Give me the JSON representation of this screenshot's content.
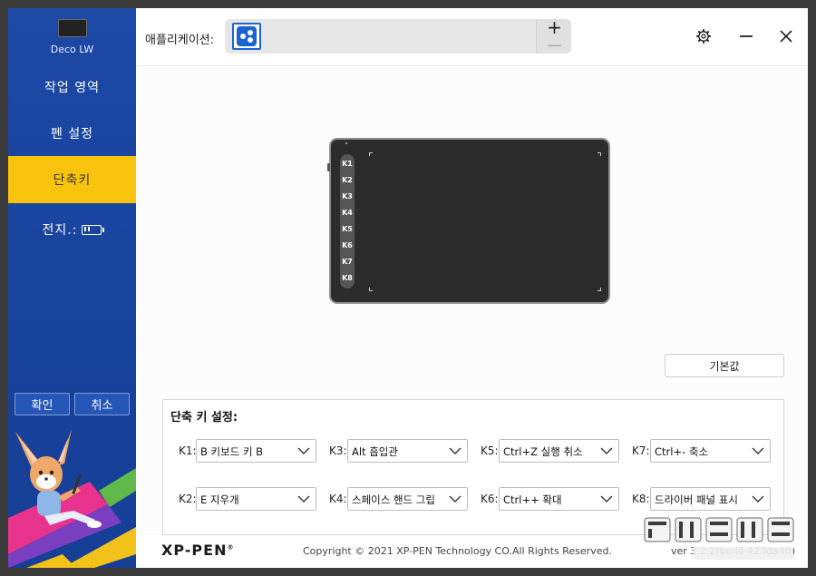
{
  "sidebar": {
    "device_name": "Deco LW",
    "nav": [
      {
        "label": "작업 영역"
      },
      {
        "label": "펜 설정"
      },
      {
        "label": "단축키"
      },
      {
        "label": "전지.:"
      }
    ],
    "confirm_label": "확인",
    "cancel_label": "취소"
  },
  "header": {
    "app_label": "애플리케이션:",
    "plus": "+",
    "minus": "—",
    "icons": [
      "settings-gear-icon",
      "minimize-icon",
      "close-icon"
    ]
  },
  "tablet": {
    "keys": [
      "K1",
      "K2",
      "K3",
      "K4",
      "K5",
      "K6",
      "K7",
      "K8"
    ]
  },
  "default_button": "기본값",
  "shortcut_settings": {
    "title": "단축 키 설정:",
    "rows": [
      [
        {
          "key": "K1:",
          "value": "B 키보드 키 B"
        },
        {
          "key": "K3:",
          "value": "Alt 흡입관"
        },
        {
          "key": "K5:",
          "value": "Ctrl+Z 실행 취소"
        },
        {
          "key": "K7:",
          "value": "Ctrl+- 축소"
        }
      ],
      [
        {
          "key": "K2:",
          "value": "E 지우개"
        },
        {
          "key": "K4:",
          "value": "스페이스 핸드 그립"
        },
        {
          "key": "K6:",
          "value": "Ctrl++ 확대"
        },
        {
          "key": "K8:",
          "value": "드라이버 패널 표시"
        }
      ]
    ]
  },
  "footer": {
    "logo": "XP-PEN",
    "copyright": "Copyright © 2021 XP-PEN Technology CO.All Rights Reserved.",
    "version": "ver 3.2.2(build 423da40)"
  },
  "colors": {
    "sidebar": "#1c49a6",
    "active_nav": "#f7c30c",
    "app_icon": "#1b63d4"
  }
}
